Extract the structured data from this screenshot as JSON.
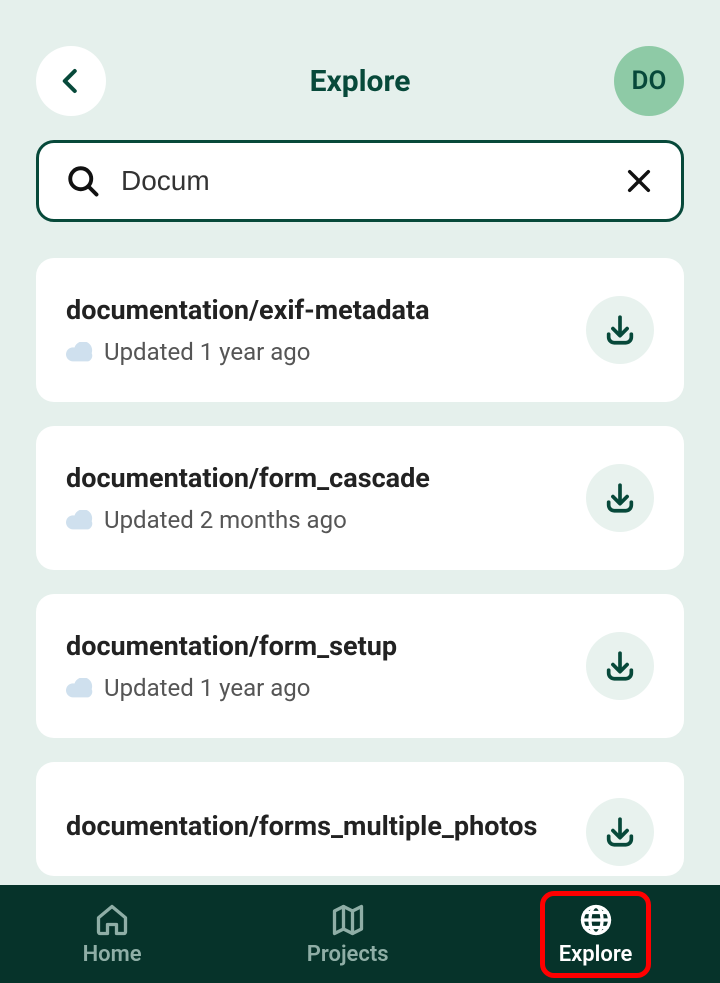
{
  "header": {
    "title": "Explore",
    "avatar_initials": "DO"
  },
  "search": {
    "value": "Docum"
  },
  "results": [
    {
      "title": "documentation/exif-metadata",
      "subtitle": "Updated 1 year ago"
    },
    {
      "title": "documentation/form_cascade",
      "subtitle": "Updated 2 months ago"
    },
    {
      "title": "documentation/form_setup",
      "subtitle": "Updated 1 year ago"
    },
    {
      "title": "documentation/forms_multiple_photos",
      "subtitle": ""
    }
  ],
  "nav": {
    "home": "Home",
    "projects": "Projects",
    "explore": "Explore"
  }
}
